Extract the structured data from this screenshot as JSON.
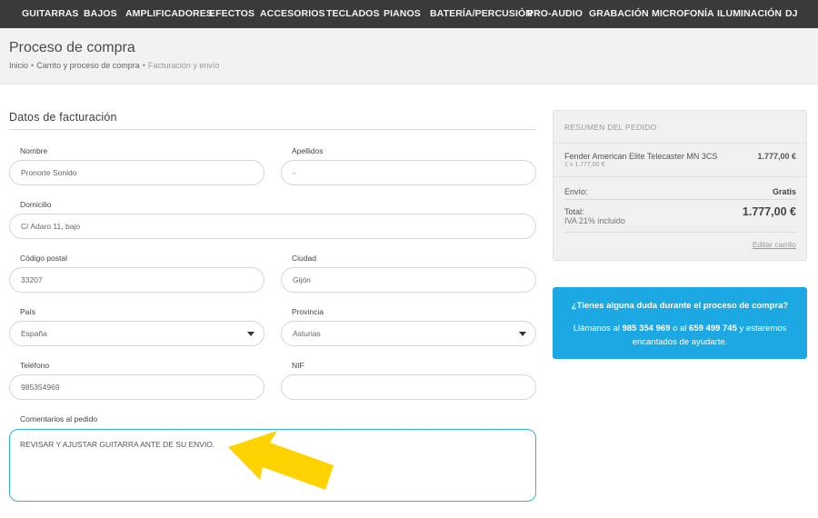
{
  "nav": [
    "GUITARRAS",
    "BAJOS",
    "AMPLIFICADORES",
    "EFECTOS",
    "ACCESORIOS",
    "TECLADOS",
    "PIANOS",
    "BATERÍA/PERCUSIÓN",
    "PRO-AUDIO",
    "GRABACIÓN",
    "MICROFONÍA",
    "ILUMINACIÓN",
    "DJ"
  ],
  "header": {
    "title": "Proceso de compra",
    "breadcrumb": [
      "Inicio",
      "Carrito y proceso de compra",
      "Facturación y envío"
    ],
    "separator": "•"
  },
  "form": {
    "title": "Datos de facturación",
    "nombre": {
      "label": "Nombre",
      "value": "Pronorte Sonido"
    },
    "apellidos": {
      "label": "Apellidos",
      "value": "-"
    },
    "domicilio": {
      "label": "Domicilio",
      "value": "C/ Adaro 11, bajo"
    },
    "cp": {
      "label": "Código postal",
      "value": "33207"
    },
    "ciudad": {
      "label": "Ciudad",
      "value": "Gijón"
    },
    "pais": {
      "label": "País",
      "value": "España"
    },
    "provincia": {
      "label": "Provincia",
      "value": "Asturias"
    },
    "telefono": {
      "label": "Teléfono",
      "value": "985354969"
    },
    "nif": {
      "label": "NIF",
      "value": ""
    },
    "comentarios": {
      "label": "Comentarios al pedido",
      "value": "REVISAR Y AJUSTAR GUITARRA ANTE DE SU ENVIO."
    }
  },
  "summary": {
    "title": "RESUMEN DEL PEDIDO",
    "product": "Fender American Elite Telecaster MN 3CS",
    "product_sub": "1 x 1.777,00 €",
    "product_price": "1.777,00 €",
    "shipping_label": "Envío:",
    "shipping_value": "Gratis",
    "total_label": "Total:",
    "total_value": "1.777,00 €",
    "iva": "IVA 21% incluido",
    "edit": "Editar carrito"
  },
  "help": {
    "title": "¿Tienes alguna duda durante el proceso de compra?",
    "text_pre": "Llámanos al",
    "phone1": "985 354 969",
    "text_mid": "o al",
    "phone2": "659 499 745",
    "text_post": "y estaremos encantados de ayudarte."
  },
  "colors": {
    "nav_bg": "#3a3a3a",
    "accent": "#1ba8e3",
    "arrow": "#ffd200",
    "focus": "#29b6d8"
  }
}
